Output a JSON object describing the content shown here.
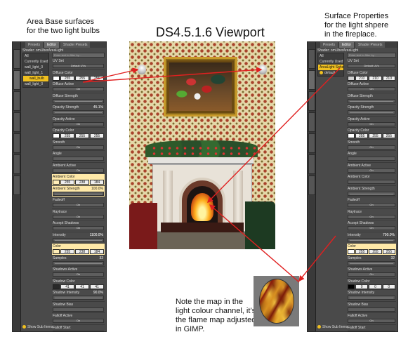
{
  "annotations": {
    "left_note": "Area Base surfaces\nfor the two light bulbs",
    "title": "DS4.5.1.6 Viewport",
    "right_note": "Surface Properties\nfor the light shpere\nin the fireplace.",
    "bottom_note": "Note the map in the\nlight colour channel, it’s\nthe flame map  adjusted\nin GIMP."
  },
  "colors": {
    "arrow": "#e02020",
    "highlight": "#ffe9a8",
    "selected": "#f0c020"
  },
  "left_panel": {
    "tabs": [
      "Presets",
      "Editor",
      "Shader Presets"
    ],
    "shader": "Shader: omUberAreaLight",
    "search": "Enter text to filter by...",
    "items": [
      {
        "label": "All"
      },
      {
        "label": "Currently Used"
      },
      {
        "label": "wall_light_0"
      },
      {
        "label": "wall_light_1"
      },
      {
        "label": "wall_bulb"
      },
      {
        "label": "wall_light_0"
      }
    ],
    "props": [
      {
        "label": "UV Set",
        "ctrl": "Default UVs"
      },
      {
        "label": "Diffuse Color",
        "r": "255",
        "g": "255",
        "b": "255"
      },
      {
        "label": "Diffuse Active",
        "ctrl": "On"
      },
      {
        "label": "Diffuse Strength",
        "value": ""
      },
      {
        "label": "Opacity Strength",
        "value": "45.1%"
      },
      {
        "label": "Opacity Active",
        "ctrl": "On"
      },
      {
        "label": "Opacity Color",
        "r": "255",
        "g": "255",
        "b": "255"
      },
      {
        "label": "Smooth",
        "ctrl": "On"
      },
      {
        "label": "Angle",
        "ctrl": ""
      },
      {
        "label": "Ambient Active",
        "ctrl": "On"
      },
      {
        "label": "Ambient Color",
        "r": "255",
        "g": "238",
        "b": "184",
        "hl": true
      },
      {
        "label": "Ambient Strength",
        "value": "100.0%",
        "hl": true
      },
      {
        "label": "Fadeoff",
        "ctrl": "On"
      },
      {
        "label": "Raytrace",
        "ctrl": "On"
      },
      {
        "label": "Accept Shadows",
        "ctrl": "On"
      },
      {
        "label": "Intensity",
        "value": "1100.0%"
      },
      {
        "label": "Color",
        "r": "255",
        "g": "238",
        "b": "184",
        "hl": true
      },
      {
        "label": "Samples",
        "value": "32"
      },
      {
        "label": "Shadows Active",
        "ctrl": "On"
      },
      {
        "label": "Shadow Color",
        "r": "41",
        "g": "41",
        "b": "41"
      },
      {
        "label": "Shadow Intensity",
        "value": "90.0%"
      },
      {
        "label": "Shadow Bias",
        "ctrl": ""
      },
      {
        "label": "Falloff Active",
        "ctrl": "On"
      },
      {
        "label": "Falloff Start",
        "ctrl": ""
      },
      {
        "label": "Falloff End",
        "value": "1000.00"
      },
      {
        "label": "Falloff Decay",
        "ctrl": ""
      }
    ],
    "footer": "Show Sub Items"
  },
  "right_panel": {
    "tabs": [
      "Presets",
      "Editor",
      "Shader Presets"
    ],
    "shader": "Shader: omUberAreaLight",
    "search": "Enter text to filter by...",
    "items": [
      {
        "label": "All"
      },
      {
        "label": "Currently Used"
      },
      {
        "label": "AreaLight Sphere 1"
      },
      {
        "label": "default"
      }
    ],
    "props": [
      {
        "label": "UV Set",
        "ctrl": "Default UVs"
      },
      {
        "label": "Diffuse Color",
        "r": "210",
        "g": "210",
        "b": "210"
      },
      {
        "label": "Diffuse Active",
        "ctrl": "On"
      },
      {
        "label": "Diffuse Strength",
        "value": ""
      },
      {
        "label": "Opacity Strength",
        "value": ""
      },
      {
        "label": "Opacity Active",
        "ctrl": "On"
      },
      {
        "label": "Opacity Color",
        "r": "255",
        "g": "255",
        "b": "255"
      },
      {
        "label": "Smooth",
        "ctrl": "On"
      },
      {
        "label": "Angle",
        "ctrl": ""
      },
      {
        "label": "Ambient Active",
        "ctrl": "On"
      },
      {
        "label": "Ambient Color",
        "ctrl": ""
      },
      {
        "label": "Ambient Strength",
        "value": ""
      },
      {
        "label": "Fadeoff",
        "ctrl": "On"
      },
      {
        "label": "Raytrace",
        "ctrl": "On"
      },
      {
        "label": "Accept Shadows",
        "ctrl": "On"
      },
      {
        "label": "Intensity",
        "value": "700.0%"
      },
      {
        "label": "Color",
        "r": "255",
        "g": "255",
        "b": "255",
        "hl": true
      },
      {
        "label": "Samples",
        "value": "32"
      },
      {
        "label": "Shadows Active",
        "ctrl": "On"
      },
      {
        "label": "Shadow Color",
        "r": "0",
        "g": "0",
        "b": "0"
      },
      {
        "label": "Shadow Intensity",
        "value": ""
      },
      {
        "label": "Shadow Bias",
        "ctrl": ""
      },
      {
        "label": "Falloff Active",
        "ctrl": "On"
      },
      {
        "label": "Falloff Start",
        "ctrl": ""
      },
      {
        "label": "Falloff End",
        "value": "1000.00"
      },
      {
        "label": "Falloff Decay",
        "ctrl": ""
      }
    ],
    "footer": "Show Sub Items"
  }
}
